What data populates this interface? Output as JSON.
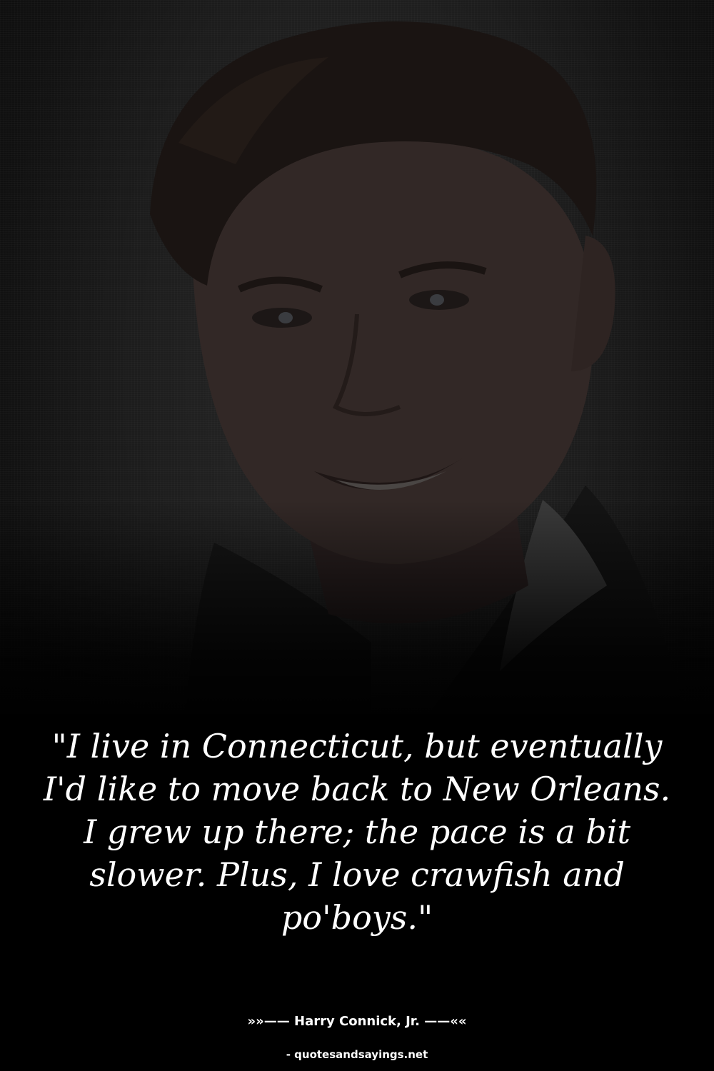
{
  "quote": {
    "text": "\"I live in Connecticut, but eventually I'd like to move back to New Orleans. I grew up there; the pace is a bit slower. Plus, I love crawfish and po'boys.\""
  },
  "attribution": {
    "text": "»»—— Harry Connick, Jr. ——««"
  },
  "source": {
    "text": "- quotesandsayings.net"
  },
  "colors": {
    "background": "#000000",
    "text": "#ffffff"
  }
}
